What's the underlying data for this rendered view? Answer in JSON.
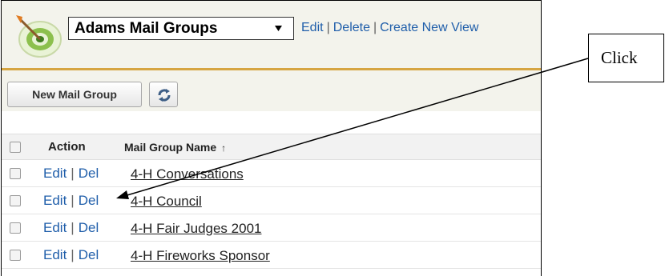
{
  "header": {
    "view_selected": "Adams Mail Groups",
    "links": [
      "Edit",
      "Delete",
      "Create New View"
    ]
  },
  "toolbar": {
    "new_button": "New Mail Group"
  },
  "table": {
    "columns": [
      "Action",
      "Mail Group Name"
    ],
    "sort_indicator": "↑",
    "rows": [
      {
        "edit": "Edit",
        "del": "Del",
        "name": "4-H Conversations"
      },
      {
        "edit": "Edit",
        "del": "Del",
        "name": "4-H Council"
      },
      {
        "edit": "Edit",
        "del": "Del",
        "name": "4-H Fair Judges 2001"
      },
      {
        "edit": "Edit",
        "del": "Del",
        "name": "4-H Fireworks Sponsor"
      }
    ]
  },
  "annotation": {
    "label": "Click"
  },
  "colors": {
    "link": "#1f5eaa",
    "accent_bar": "#d6a542",
    "header_bg": "#f3f3ec"
  }
}
